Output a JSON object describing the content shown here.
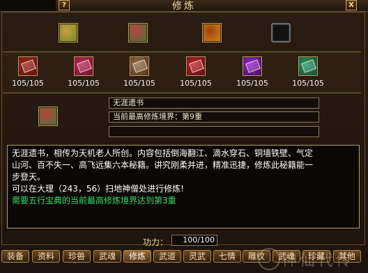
{
  "window": {
    "title": "修炼",
    "help_label": "?",
    "close_label": "X"
  },
  "top_slots": [
    {
      "icon": "book-stack-icon",
      "color_a": "#6c8a2a",
      "color_b": "#c8a040"
    },
    {
      "icon": "green-chest-icon",
      "color_a": "#3a7a3a",
      "color_b": "#c04040"
    },
    {
      "icon": "gold-chest-icon",
      "color_a": "#d08a20",
      "color_b": "#a04010"
    },
    {
      "icon": "empty-slot",
      "color_a": "#111111",
      "color_b": "#111111"
    }
  ],
  "books": [
    {
      "count": "105/105",
      "color_a": "#a0281e",
      "color_b": "#5a120c"
    },
    {
      "count": "105/105",
      "color_a": "#c0285a",
      "color_b": "#6a102c"
    },
    {
      "count": "105/105",
      "color_a": "#9a7048",
      "color_b": "#4a3220"
    },
    {
      "count": "105/105",
      "color_a": "#c02030",
      "color_b": "#5a0c14"
    },
    {
      "count": "105/105",
      "color_a": "#9a2ad0",
      "color_b": "#3c0c5a"
    },
    {
      "count": "105/105",
      "color_a": "#2a9a6a",
      "color_b": "#0c4a30"
    }
  ],
  "selected": {
    "icon": "green-chest-icon",
    "name": "无涯遗书",
    "realm": "当前最高修炼境界：第9重",
    "extra": ""
  },
  "description": {
    "line1": "无涯遗书，相传为天机老人所创。内容包括倒海翻江、滴水穿石、铜墙铁壁、气定",
    "line2": "山河、百不失一、高飞远集六本秘籍。讲究刚柔并进，精准迅捷，修炼此秘籍能一",
    "line3": "步登天。",
    "line4": "可以在大理（243，56）扫地神僧处进行修炼!",
    "line5": "需要五行宝典的当前最高修炼境界达到第3重"
  },
  "power": {
    "label": "功力：",
    "value": "100/100"
  },
  "tabs": [
    "装备",
    "资料",
    "珍兽",
    "武魂",
    "修炼",
    "武道",
    "灵武",
    "七情",
    "雕纹",
    "武魂",
    "珍藏",
    "其他"
  ],
  "active_tab": 4,
  "watermark": "神仙代传"
}
